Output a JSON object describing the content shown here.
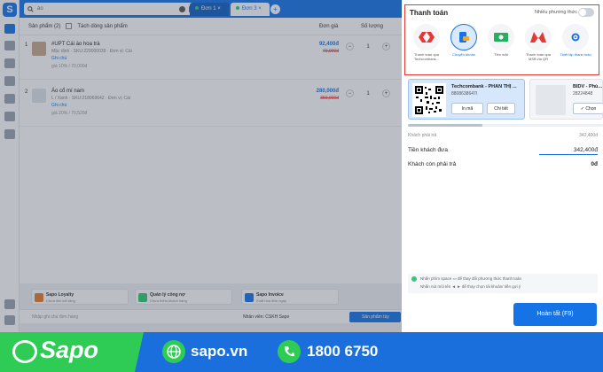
{
  "app": {
    "logo_letter": "S"
  },
  "topbar": {
    "search_placeholder": "ảo",
    "tabs": [
      {
        "label": "Đơn 1"
      },
      {
        "label": "Đơn 3"
      }
    ],
    "add_tab": "+"
  },
  "cart": {
    "header_label": "Sản phẩm",
    "header_count": "(2)",
    "split_label": "Tách dòng sản phẩm",
    "col_price": "Đơn giá",
    "col_qty": "Số lượng",
    "items": [
      {
        "num": "1",
        "name": "#UPT Cái áo hoa trà",
        "sku": "Mặc định · SKU:229000039 · Đơn vị: Cái",
        "note": "Ghi chú",
        "promo": "giá 10% / 70,000đ",
        "price": "92,400đ",
        "old_price": "70,000đ",
        "qty": "1"
      },
      {
        "num": "2",
        "name": "Áo cổ mí nam",
        "sku": "L / Xanh · SKU:218069642 · Đơn vị: Cái",
        "note": "Ghi chú",
        "promo": "giá 20% / 70,520đ",
        "price": "280,000đ",
        "old_price": "350,000đ",
        "qty": "1"
      }
    ]
  },
  "promos": [
    {
      "title": "Sapo Loyalty",
      "sub": "Chưa liên kết tăng",
      "color": "#e57c2f"
    },
    {
      "title": "Quản lý công nợ",
      "sub": "Chưa thêm khách hàng",
      "color": "#2ecc71"
    },
    {
      "title": "Sapo Invoice",
      "sub": "Xuất hóa đơn ngay",
      "color": "#1573e6"
    }
  ],
  "bottom": {
    "order_note": "Nhập ghi chú đơn hàng",
    "staff": "Nhân viên: CSKH Sapo",
    "add_btn": "Sản phẩm tùy"
  },
  "payment": {
    "title": "Thanh toán",
    "multi_label": "Nhiều phương thức",
    "methods": [
      {
        "label": "Thanh toán qua Techcombank...",
        "icon": "techcombank-icon",
        "selected": false
      },
      {
        "label": "Chuyển khoản",
        "icon": "bank-transfer-icon",
        "selected": true
      },
      {
        "label": "Tiền mặt",
        "icon": "cash-icon",
        "selected": false
      },
      {
        "label": "Thanh toán qua MSB via QR",
        "icon": "msb-icon",
        "selected": false
      },
      {
        "label": "Thiết lập thanh toán",
        "icon": "settings-icon",
        "selected": false
      }
    ],
    "banks": [
      {
        "name": "Techcombank - PHAN THỊ ...",
        "account": "8808638647I",
        "print_btn": "In mã",
        "detail_btn": "Chi tiết"
      },
      {
        "name": "BIDV - Phù...",
        "account": "28224848",
        "choose_btn": "Chọn"
      }
    ],
    "customer_must_pay_label": "Khách phải trả",
    "customer_must_pay": "342,400đ",
    "customer_gave_label": "Tiền khách đưa",
    "customer_gave": "342,400đ",
    "remaining_label": "Khách còn phải trả",
    "remaining": "0đ",
    "hint_line1": "Nhấn phím space ▭ để thay đổi phương thức thanh toán",
    "hint_line2": "Nhấn nút mũi tên ◄ ► để thay chọn tài khoản/ tiền gợi ý",
    "finish_btn": "Hoàn tất (F9)"
  },
  "banner": {
    "brand": "Sapo",
    "website": "sapo.vn",
    "hotline": "1800 6750",
    "green": "#2ecc54",
    "blue": "#1a6fdc"
  },
  "colors": {
    "accent": "#1573e6",
    "highlight": "#e53935"
  }
}
